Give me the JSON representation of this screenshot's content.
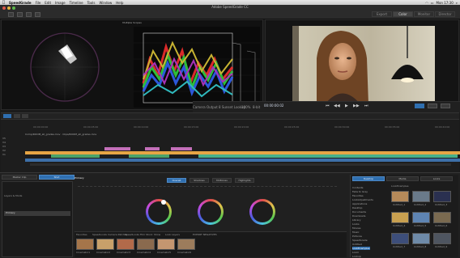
{
  "menubar": {
    "apple": "",
    "app": "SpeedGrade",
    "items": [
      "File",
      "Edit",
      "Image",
      "Timeline",
      "Tools",
      "Window",
      "Help"
    ],
    "clock": "Mon 17:30"
  },
  "window": {
    "title": "Adobe SpeedGrade CC",
    "workspace_tabs": [
      "Export",
      "Color",
      "Monitor",
      "Director"
    ],
    "active_tab": "Color"
  },
  "scopes": {
    "title": "Multiple Scopes"
  },
  "transport": {
    "timecode": "00:00:00:02",
    "mode_label": "Camera Output",
    "zoom": "100%",
    "render_label": "8 Sunset Lookup",
    "filter_label": "8-bit"
  },
  "timeline": {
    "track_names": [
      "V1",
      "V2",
      "V3",
      "V4",
      "V5"
    ],
    "ruler": [
      "00:00:00:00",
      "00:00:05:00",
      "00:00:10:00",
      "00:00:15:00",
      "00:00:20:00",
      "00:00:25:00",
      "00:00:30:00",
      "00:00:35:00",
      "00:00:40:00"
    ],
    "sequence_label": "Comp/ROOM_all_grades.mov  ·  Clips/ROOM_all_grades.mov"
  },
  "lower": {
    "left_tabs": [
      "Master Clip",
      "Shot"
    ],
    "layer_tabs": [
      "Primary",
      "Secondary",
      "Look",
      "Effects"
    ],
    "range_tabs": [
      "Overall",
      "Shadows",
      "Midtones",
      "Highlights"
    ],
    "panel_title": "Layers & Mode",
    "layer_item": "Primary",
    "looks_tabs": [
      "Favorites",
      "SpeedLooks Camera Patches",
      "SpeedLooks Film Stock",
      "Show",
      "Look Layers",
      "EXPORT NEGATIVES"
    ],
    "looks_labels": [
      "Cinematic1",
      "Cinematic2",
      "Cinematic3",
      "Cinematic4",
      "Cinematic5",
      "Cinematic6",
      "Cinematic7",
      "Cinematic8"
    ]
  },
  "browser": {
    "tabs": [
      "Desktop",
      "Media",
      "Looks"
    ],
    "tree": [
      "Contents",
      "Fade to Grey",
      "Favorites",
      "LookAdjustments",
      "Applications",
      "Desktop",
      "Documents",
      "Downloads",
      "Library",
      "Looks",
      "Movies",
      "Music",
      "Pictures",
      "SpeedGrade",
      "Untitled",
      "LookExamples",
      "Loom",
      "Lookup"
    ],
    "path": "LookExamples",
    "thumb_labels": [
      "Untitled_1",
      "Untitled_2",
      "Untitled_3",
      "Untitled_4",
      "Untitled_5",
      "Untitled_6",
      "Untitled_7",
      "Untitled_8",
      "Untitled_9"
    ]
  }
}
